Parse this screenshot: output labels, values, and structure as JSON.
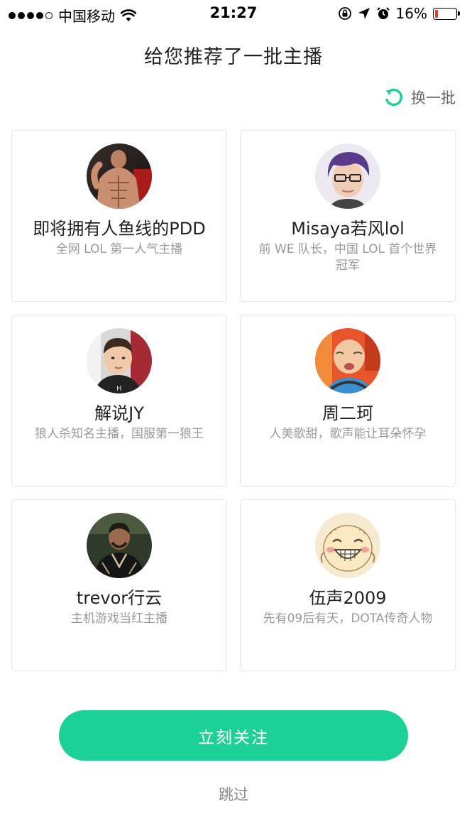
{
  "status_bar": {
    "carrier": "中国移动",
    "time": "21:27",
    "battery": "16%",
    "battery_level": 0.16
  },
  "page": {
    "title": "给您推荐了一批主播",
    "refresh_label": "换一批",
    "follow_label": "立刻关注",
    "skip_label": "跳过"
  },
  "streamers": [
    {
      "name": "即将拥有人鱼线的PDD",
      "desc": "全网 LOL 第一人气主播"
    },
    {
      "name": "Misaya若风lol",
      "desc": "前 WE 队长，中国 LOL 首个世界冠军"
    },
    {
      "name": "解说JY",
      "desc": "狼人杀知名主播，国服第一狼王"
    },
    {
      "name": "周二珂",
      "desc": "人美歌甜，歌声能让耳朵怀孕"
    },
    {
      "name": "trevor行云",
      "desc": "主机游戏当红主播"
    },
    {
      "name": "伍声2009",
      "desc": "先有09后有天，DOTA传奇人物"
    }
  ],
  "colors": {
    "accent": "#1dd196",
    "battery_low": "#e53935"
  },
  "icons": {
    "refresh": "refresh-icon",
    "wifi": "wifi-icon",
    "lock": "orientation-lock-icon",
    "location": "location-arrow-icon",
    "alarm": "alarm-icon",
    "battery": "battery-icon"
  }
}
